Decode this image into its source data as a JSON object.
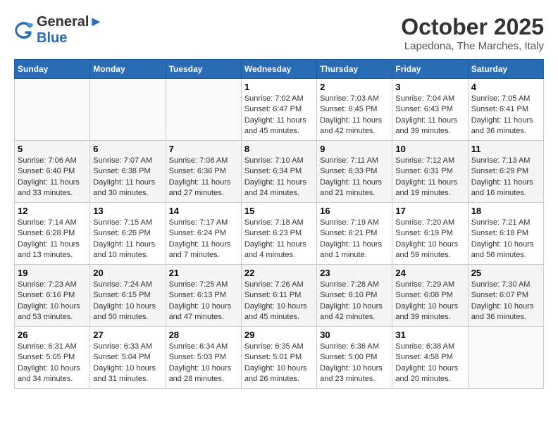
{
  "header": {
    "logo_line1": "General",
    "logo_line2": "Blue",
    "month": "October 2025",
    "location": "Lapedona, The Marches, Italy"
  },
  "weekdays": [
    "Sunday",
    "Monday",
    "Tuesday",
    "Wednesday",
    "Thursday",
    "Friday",
    "Saturday"
  ],
  "weeks": [
    [
      {
        "num": "",
        "info": ""
      },
      {
        "num": "",
        "info": ""
      },
      {
        "num": "",
        "info": ""
      },
      {
        "num": "1",
        "info": "Sunrise: 7:02 AM\nSunset: 6:47 PM\nDaylight: 11 hours and 45 minutes."
      },
      {
        "num": "2",
        "info": "Sunrise: 7:03 AM\nSunset: 6:45 PM\nDaylight: 11 hours and 42 minutes."
      },
      {
        "num": "3",
        "info": "Sunrise: 7:04 AM\nSunset: 6:43 PM\nDaylight: 11 hours and 39 minutes."
      },
      {
        "num": "4",
        "info": "Sunrise: 7:05 AM\nSunset: 6:41 PM\nDaylight: 11 hours and 36 minutes."
      }
    ],
    [
      {
        "num": "5",
        "info": "Sunrise: 7:06 AM\nSunset: 6:40 PM\nDaylight: 11 hours and 33 minutes."
      },
      {
        "num": "6",
        "info": "Sunrise: 7:07 AM\nSunset: 6:38 PM\nDaylight: 11 hours and 30 minutes."
      },
      {
        "num": "7",
        "info": "Sunrise: 7:08 AM\nSunset: 6:36 PM\nDaylight: 11 hours and 27 minutes."
      },
      {
        "num": "8",
        "info": "Sunrise: 7:10 AM\nSunset: 6:34 PM\nDaylight: 11 hours and 24 minutes."
      },
      {
        "num": "9",
        "info": "Sunrise: 7:11 AM\nSunset: 6:33 PM\nDaylight: 11 hours and 21 minutes."
      },
      {
        "num": "10",
        "info": "Sunrise: 7:12 AM\nSunset: 6:31 PM\nDaylight: 11 hours and 19 minutes."
      },
      {
        "num": "11",
        "info": "Sunrise: 7:13 AM\nSunset: 6:29 PM\nDaylight: 11 hours and 16 minutes."
      }
    ],
    [
      {
        "num": "12",
        "info": "Sunrise: 7:14 AM\nSunset: 6:28 PM\nDaylight: 11 hours and 13 minutes."
      },
      {
        "num": "13",
        "info": "Sunrise: 7:15 AM\nSunset: 6:26 PM\nDaylight: 11 hours and 10 minutes."
      },
      {
        "num": "14",
        "info": "Sunrise: 7:17 AM\nSunset: 6:24 PM\nDaylight: 11 hours and 7 minutes."
      },
      {
        "num": "15",
        "info": "Sunrise: 7:18 AM\nSunset: 6:23 PM\nDaylight: 11 hours and 4 minutes."
      },
      {
        "num": "16",
        "info": "Sunrise: 7:19 AM\nSunset: 6:21 PM\nDaylight: 11 hours and 1 minute."
      },
      {
        "num": "17",
        "info": "Sunrise: 7:20 AM\nSunset: 6:19 PM\nDaylight: 10 hours and 59 minutes."
      },
      {
        "num": "18",
        "info": "Sunrise: 7:21 AM\nSunset: 6:18 PM\nDaylight: 10 hours and 56 minutes."
      }
    ],
    [
      {
        "num": "19",
        "info": "Sunrise: 7:23 AM\nSunset: 6:16 PM\nDaylight: 10 hours and 53 minutes."
      },
      {
        "num": "20",
        "info": "Sunrise: 7:24 AM\nSunset: 6:15 PM\nDaylight: 10 hours and 50 minutes."
      },
      {
        "num": "21",
        "info": "Sunrise: 7:25 AM\nSunset: 6:13 PM\nDaylight: 10 hours and 47 minutes."
      },
      {
        "num": "22",
        "info": "Sunrise: 7:26 AM\nSunset: 6:11 PM\nDaylight: 10 hours and 45 minutes."
      },
      {
        "num": "23",
        "info": "Sunrise: 7:28 AM\nSunset: 6:10 PM\nDaylight: 10 hours and 42 minutes."
      },
      {
        "num": "24",
        "info": "Sunrise: 7:29 AM\nSunset: 6:08 PM\nDaylight: 10 hours and 39 minutes."
      },
      {
        "num": "25",
        "info": "Sunrise: 7:30 AM\nSunset: 6:07 PM\nDaylight: 10 hours and 36 minutes."
      }
    ],
    [
      {
        "num": "26",
        "info": "Sunrise: 6:31 AM\nSunset: 5:05 PM\nDaylight: 10 hours and 34 minutes."
      },
      {
        "num": "27",
        "info": "Sunrise: 6:33 AM\nSunset: 5:04 PM\nDaylight: 10 hours and 31 minutes."
      },
      {
        "num": "28",
        "info": "Sunrise: 6:34 AM\nSunset: 5:03 PM\nDaylight: 10 hours and 28 minutes."
      },
      {
        "num": "29",
        "info": "Sunrise: 6:35 AM\nSunset: 5:01 PM\nDaylight: 10 hours and 26 minutes."
      },
      {
        "num": "30",
        "info": "Sunrise: 6:36 AM\nSunset: 5:00 PM\nDaylight: 10 hours and 23 minutes."
      },
      {
        "num": "31",
        "info": "Sunrise: 6:38 AM\nSunset: 4:58 PM\nDaylight: 10 hours and 20 minutes."
      },
      {
        "num": "",
        "info": ""
      }
    ]
  ]
}
